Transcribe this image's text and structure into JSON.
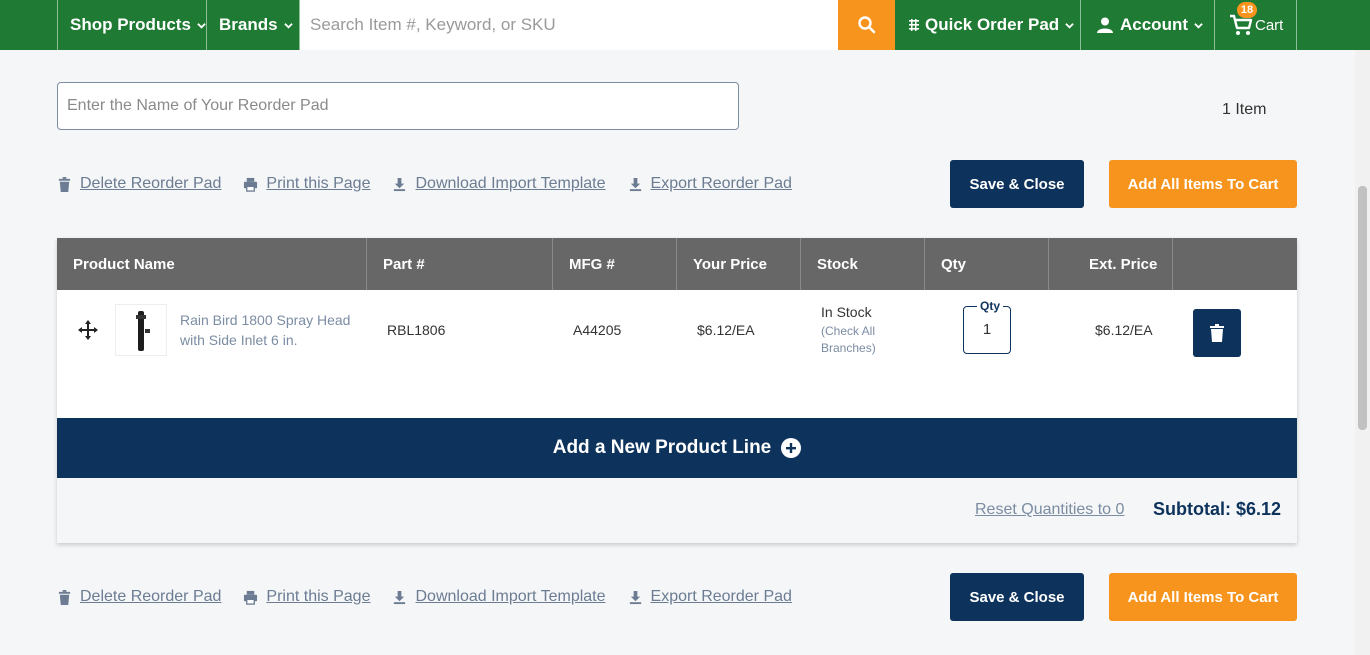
{
  "nav": {
    "shop_products": "Shop Products",
    "brands": "Brands",
    "search_placeholder": "Search Item #, Keyword, or SKU",
    "quick_order_pad": "Quick Order Pad",
    "account": "Account",
    "cart": "Cart",
    "cart_count": "18"
  },
  "colors": {
    "brand_green": "#1f7a33",
    "accent_orange": "#f7941d",
    "navy": "#0d325c"
  },
  "reorder_pad": {
    "name_placeholder": "Enter the Name of Your Reorder Pad",
    "name_value": "",
    "item_count": "1 Item"
  },
  "actions": {
    "delete": "Delete Reorder Pad",
    "print": "Print this Page",
    "download_template": "Download Import Template",
    "export": "Export Reorder Pad",
    "save_close": "Save & Close",
    "add_all": "Add All Items To Cart"
  },
  "table": {
    "headers": [
      "Product Name",
      "Part #",
      "MFG #",
      "Your Price",
      "Stock",
      "Qty",
      "Ext. Price"
    ],
    "rows": [
      {
        "product_name": "Rain Bird 1800 Spray Head with Side Inlet 6 in.",
        "part": "RBL1806",
        "mfg": "A44205",
        "price": "$6.12/EA",
        "stock": "In Stock",
        "stock_link": "(Check All Branches)",
        "qty_label": "Qty",
        "qty": "1",
        "ext_price": "$6.12/EA"
      }
    ],
    "add_line": "Add a New Product Line",
    "reset": "Reset Quantities to 0",
    "subtotal": "Subtotal: $6.12"
  }
}
